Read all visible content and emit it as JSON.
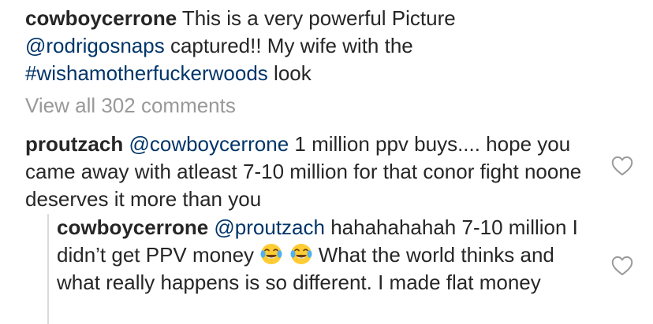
{
  "caption": {
    "username": "cowboycerrone",
    "text_1": " This is a very powerful Picture ",
    "mention": "@rodrigosnaps",
    "text_2": " captured!! My wife with the ",
    "hashtag": "#wishamotherfuckerwoods",
    "text_3": " look"
  },
  "view_all_comments": "View all 302 comments",
  "comment": {
    "username": "proutzach",
    "mention": "@cowboycerrone",
    "text": "  1 million ppv buys.... hope you came away with atleast 7-10 million for that conor fight noone deserves it more than you",
    "like_icon": "heart-outline-icon"
  },
  "reply": {
    "username": "cowboycerrone",
    "mention": "@proutzach",
    "text_1": " hahahahahah 7-10 million I didn’t get PPV money ",
    "emoji": "face-with-tears-of-joy",
    "text_2": " What the world thinks and what really happens is so different.  I made flat money",
    "like_icon": "heart-outline-icon"
  },
  "colors": {
    "text": "#262626",
    "link": "#003569",
    "muted": "#999999",
    "thread_line": "#dbdbdb"
  }
}
